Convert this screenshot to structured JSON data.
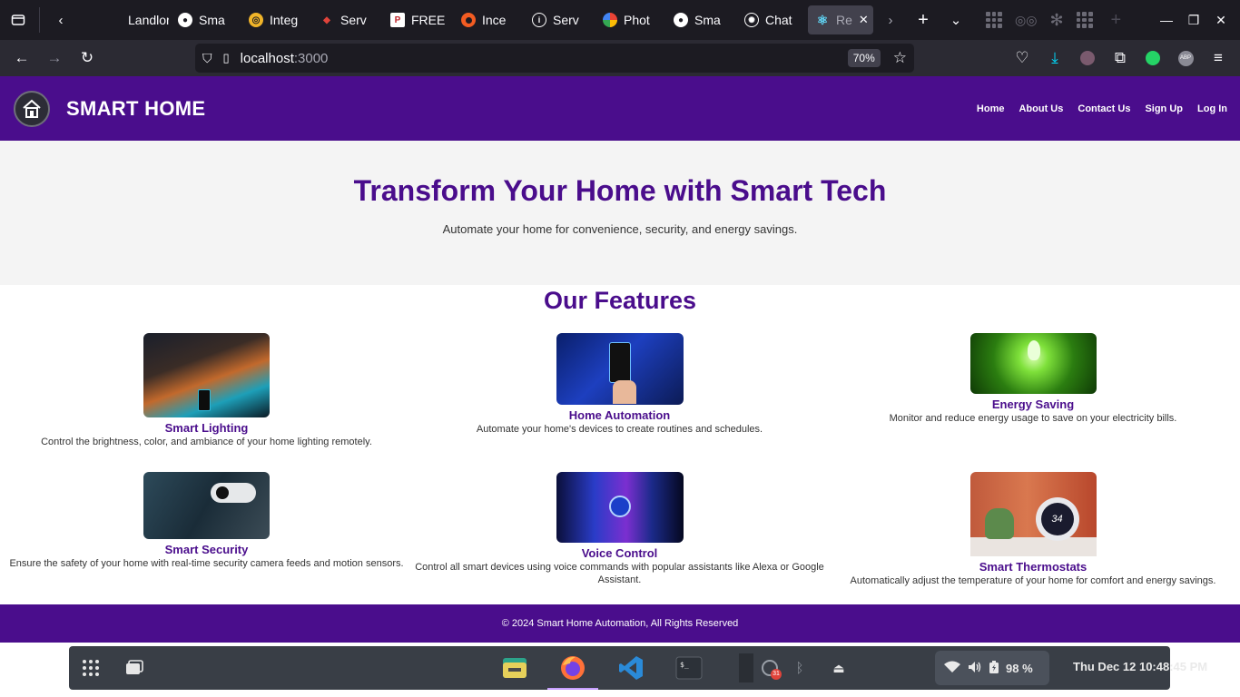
{
  "browser": {
    "tabs": [
      {
        "label": "Landlor",
        "icon": "landlord-favicon",
        "color": "#1c1b22"
      },
      {
        "label": "Sma",
        "icon": "github-icon",
        "color": "#ffffff"
      },
      {
        "label": "Integ",
        "icon": "integration-favicon",
        "color": "#f0b429"
      },
      {
        "label": "Serv",
        "icon": "service-favicon",
        "color": "#e0433a"
      },
      {
        "label": "FREE",
        "icon": "free-favicon",
        "color": "#ffffff"
      },
      {
        "label": "Ince",
        "icon": "incident-favicon",
        "color": "#f25c22"
      },
      {
        "label": "Serv",
        "icon": "info-favicon",
        "color": "#ffffff"
      },
      {
        "label": "Phot",
        "icon": "photos-favicon",
        "color": "#34a853"
      },
      {
        "label": "Sma",
        "icon": "github-icon",
        "color": "#ffffff"
      },
      {
        "label": "Chat",
        "icon": "chatgpt-icon",
        "color": "#ffffff"
      }
    ],
    "active_tab": {
      "label": "Re",
      "icon": "react-icon"
    },
    "url_host": "localhost",
    "url_port": ":3000",
    "zoom": "70%"
  },
  "app": {
    "brand": "SMART HOME",
    "menu": [
      "Home",
      "About Us",
      "Contact Us",
      "Sign Up",
      "Log In"
    ],
    "hero_title": "Transform Your Home with Smart Tech",
    "hero_subtitle": "Automate your home for convenience, security, and energy savings.",
    "features_title": "Our Features",
    "features": [
      {
        "title": "Smart Lighting",
        "desc": "Control the brightness, color, and ambiance of your home lighting remotely."
      },
      {
        "title": "Home Automation",
        "desc": "Automate your home's devices to create routines and schedules."
      },
      {
        "title": "Energy Saving",
        "desc": "Monitor and reduce energy usage to save on your electricity bills."
      },
      {
        "title": "Smart Security",
        "desc": "Ensure the safety of your home with real-time security camera feeds and motion sensors."
      },
      {
        "title": "Voice Control",
        "desc": "Control all smart devices using voice commands with popular assistants like Alexa or Google Assistant."
      },
      {
        "title": "Smart Thermostats",
        "desc": "Automatically adjust the temperature of your home for comfort and energy savings."
      }
    ],
    "footer": "© 2024 Smart Home Automation, All Rights Reserved",
    "thermostat_reading": "34"
  },
  "taskbar": {
    "battery": "98 %",
    "clock": "Thu Dec 12  10:48:45 PM",
    "calendar_badge": "31"
  },
  "colors": {
    "brand_purple": "#4a0d8c",
    "hero_bg": "#f4f4f4",
    "browser_dark": "#1c1b22"
  }
}
